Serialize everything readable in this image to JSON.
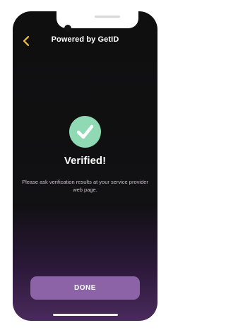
{
  "header": {
    "title": "Powered by GetID",
    "back_icon": "chevron-left-icon",
    "back_color": "#f5c242"
  },
  "status": {
    "icon": "check-icon",
    "icon_bg_color": "#8fd9b4",
    "heading": "Verified!",
    "message": "Please ask verification results at your service provider web page."
  },
  "actions": {
    "done_label": "DONE",
    "done_color": "#8d63a8"
  }
}
